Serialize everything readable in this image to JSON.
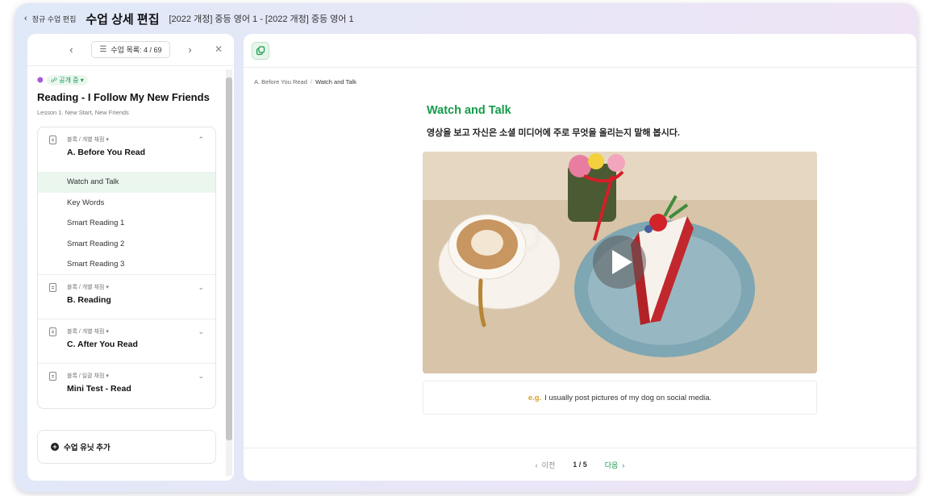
{
  "header": {
    "back_label": "정규 수업 편집",
    "page_title": "수업 상세 편집",
    "course_title": "[2022 개정] 중등 영어 1 - [2022 개정] 중등 영어 1"
  },
  "left_nav": {
    "list_label": "수업 목록: 4 / 69"
  },
  "lesson": {
    "status": "공개 중",
    "title": "Reading - I Follow My New Friends",
    "subtitle": "Lesson 1. New Start, New Friends"
  },
  "blocks": [
    {
      "meta": "블록 / 개별 채점",
      "title": "A. Before You Read",
      "items": [
        "Watch and Talk",
        "Key Words",
        "Smart Reading 1",
        "Smart Reading 2",
        "Smart Reading 3"
      ]
    },
    {
      "meta": "블록 / 개별 채점",
      "title": "B. Reading"
    },
    {
      "meta": "블록 / 개별 채점",
      "title": "C. After You Read"
    },
    {
      "meta": "블록 / 일괄 채점",
      "title": "Mini Test - Read"
    }
  ],
  "add_unit_label": "수업 유닛 추가",
  "breadcrumb": {
    "parent": "A. Before You Read",
    "current": "Watch and Talk"
  },
  "content": {
    "title": "Watch and Talk",
    "instruction": "영상을 보고 자신은 소셜 미디어에 주로 무엇을 올리는지 말해 봅시다.",
    "example_prefix": "e.g.",
    "example_text": "I usually post pictures of my dog on social media."
  },
  "pager": {
    "prev": "이전",
    "indicator": "1 / 5",
    "next": "다음"
  },
  "colors": {
    "accent_green": "#149b4a",
    "example_gold": "#d9a12a",
    "status_purple": "#a55bd6"
  }
}
